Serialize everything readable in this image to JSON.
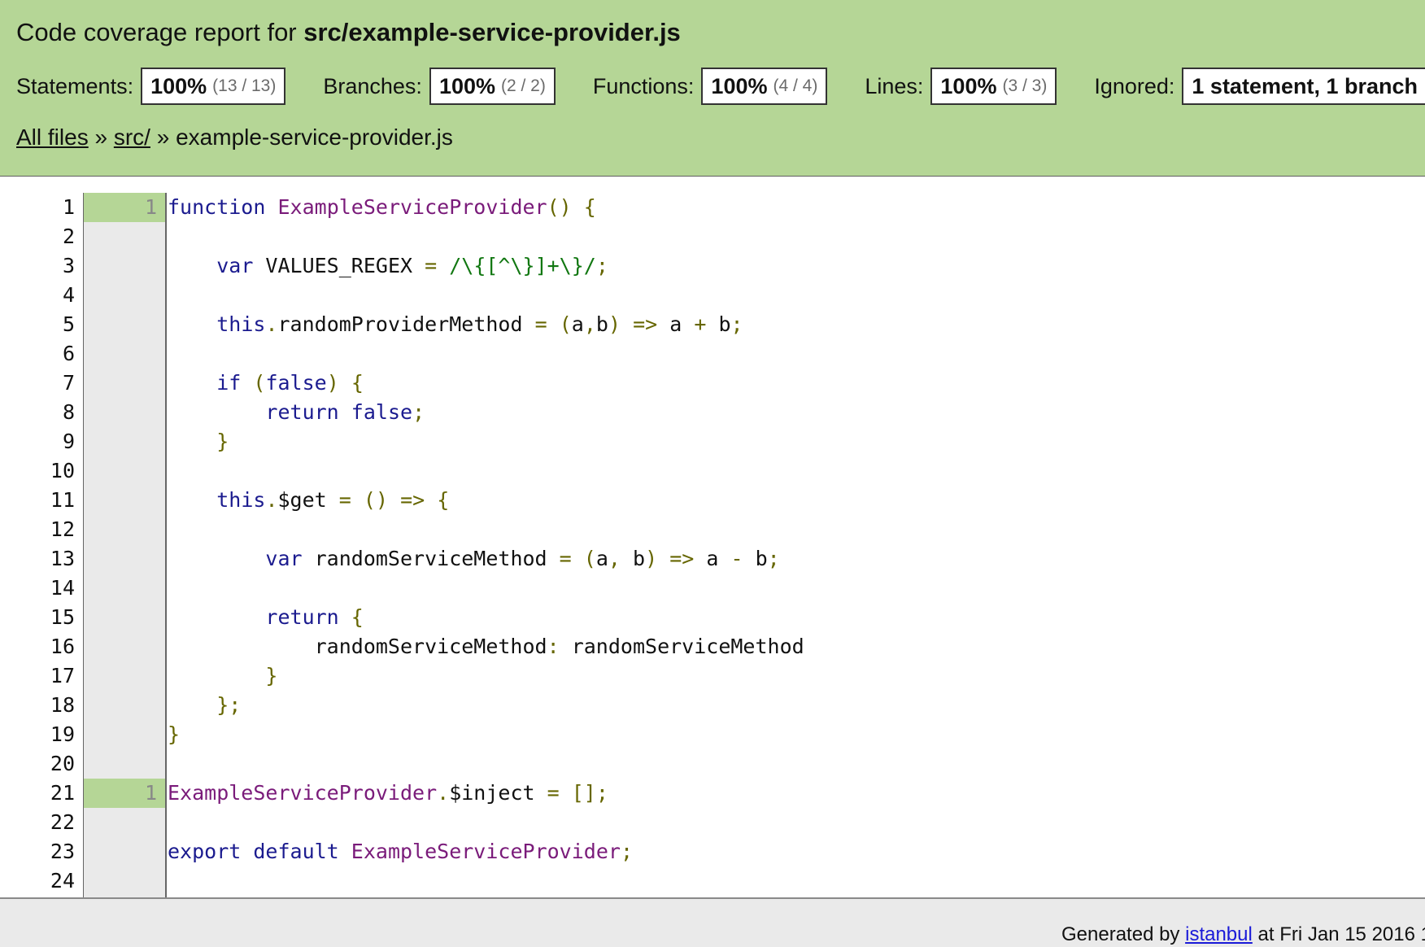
{
  "header": {
    "title_prefix": "Code coverage report for ",
    "title_file": "src/example-service-provider.js",
    "stats": [
      {
        "label": "Statements:",
        "pct": "100%",
        "frac": "(13 / 13)"
      },
      {
        "label": "Branches:",
        "pct": "100%",
        "frac": "(2 / 2)"
      },
      {
        "label": "Functions:",
        "pct": "100%",
        "frac": "(4 / 4)"
      },
      {
        "label": "Lines:",
        "pct": "100%",
        "frac": "(3 / 3)"
      }
    ],
    "ignored": {
      "label": "Ignored:",
      "value": "1 statement, 1 branch"
    },
    "colors": {
      "header_bg": "#b5d696",
      "hit": "#b5d696"
    }
  },
  "breadcrumb": {
    "all_files": "All files",
    "sep1": " » ",
    "src": "src/",
    "sep2": " » ",
    "file": "example-service-provider.js"
  },
  "code": {
    "line_numbers": [
      "1",
      "2",
      "3",
      "4",
      "5",
      "6",
      "7",
      "8",
      "9",
      "10",
      "11",
      "12",
      "13",
      "14",
      "15",
      "16",
      "17",
      "18",
      "19",
      "20",
      "21",
      "22",
      "23",
      "24"
    ],
    "counts": [
      "1",
      "",
      "",
      "",
      "",
      "",
      "",
      "",
      "",
      "",
      "",
      "",
      "",
      "",
      "",
      "",
      "",
      "",
      "",
      "",
      "1",
      "",
      "",
      ""
    ],
    "lines": [
      [
        [
          "kw",
          "function"
        ],
        [
          "pl",
          " "
        ],
        [
          "fn",
          "ExampleServiceProvider"
        ],
        [
          "pu",
          "() {"
        ]
      ],
      [],
      [
        [
          "pl",
          "    "
        ],
        [
          "kw",
          "var"
        ],
        [
          "pl",
          " VALUES_REGEX "
        ],
        [
          "pu",
          "="
        ],
        [
          "pl",
          " "
        ],
        [
          "rx",
          "/\\{[^\\}]+\\}/"
        ],
        [
          "pu",
          ";"
        ]
      ],
      [],
      [
        [
          "pl",
          "    "
        ],
        [
          "kw",
          "this"
        ],
        [
          "pu",
          "."
        ],
        [
          "pl",
          "randomProviderMethod "
        ],
        [
          "pu",
          "="
        ],
        [
          "pl",
          " "
        ],
        [
          "pu",
          "("
        ],
        [
          "pl",
          "a"
        ],
        [
          "pu",
          ","
        ],
        [
          "pl",
          "b"
        ],
        [
          "pu",
          ")"
        ],
        [
          "pl",
          " "
        ],
        [
          "pu",
          "=>"
        ],
        [
          "pl",
          " a "
        ],
        [
          "pu",
          "+"
        ],
        [
          "pl",
          " b"
        ],
        [
          "pu",
          ";"
        ]
      ],
      [],
      [
        [
          "pl",
          "    "
        ],
        [
          "kw",
          "if"
        ],
        [
          "pl",
          " "
        ],
        [
          "pu",
          "("
        ],
        [
          "kw",
          "false"
        ],
        [
          "pu",
          ")"
        ],
        [
          "pl",
          " "
        ],
        [
          "pu",
          "{"
        ]
      ],
      [
        [
          "pl",
          "        "
        ],
        [
          "kw",
          "return"
        ],
        [
          "pl",
          " "
        ],
        [
          "kw",
          "false"
        ],
        [
          "pu",
          ";"
        ]
      ],
      [
        [
          "pl",
          "    "
        ],
        [
          "pu",
          "}"
        ]
      ],
      [],
      [
        [
          "pl",
          "    "
        ],
        [
          "kw",
          "this"
        ],
        [
          "pu",
          "."
        ],
        [
          "pl",
          "$get "
        ],
        [
          "pu",
          "="
        ],
        [
          "pl",
          " "
        ],
        [
          "pu",
          "()"
        ],
        [
          "pl",
          " "
        ],
        [
          "pu",
          "=>"
        ],
        [
          "pl",
          " "
        ],
        [
          "pu",
          "{"
        ]
      ],
      [],
      [
        [
          "pl",
          "        "
        ],
        [
          "kw",
          "var"
        ],
        [
          "pl",
          " randomServiceMethod "
        ],
        [
          "pu",
          "="
        ],
        [
          "pl",
          " "
        ],
        [
          "pu",
          "("
        ],
        [
          "pl",
          "a"
        ],
        [
          "pu",
          ","
        ],
        [
          "pl",
          " b"
        ],
        [
          "pu",
          ")"
        ],
        [
          "pl",
          " "
        ],
        [
          "pu",
          "=>"
        ],
        [
          "pl",
          " a "
        ],
        [
          "pu",
          "-"
        ],
        [
          "pl",
          " b"
        ],
        [
          "pu",
          ";"
        ]
      ],
      [],
      [
        [
          "pl",
          "        "
        ],
        [
          "kw",
          "return"
        ],
        [
          "pl",
          " "
        ],
        [
          "pu",
          "{"
        ]
      ],
      [
        [
          "pl",
          "            randomServiceMethod"
        ],
        [
          "pu",
          ":"
        ],
        [
          "pl",
          " randomServiceMethod"
        ]
      ],
      [
        [
          "pl",
          "        "
        ],
        [
          "pu",
          "}"
        ]
      ],
      [
        [
          "pl",
          "    "
        ],
        [
          "pu",
          "};"
        ]
      ],
      [
        [
          "pu",
          "}"
        ]
      ],
      [],
      [
        [
          "fn",
          "ExampleServiceProvider"
        ],
        [
          "pu",
          "."
        ],
        [
          "pl",
          "$inject "
        ],
        [
          "pu",
          "="
        ],
        [
          "pl",
          " "
        ],
        [
          "pu",
          "[];"
        ]
      ],
      [],
      [
        [
          "kw",
          "export"
        ],
        [
          "pl",
          " "
        ],
        [
          "kw",
          "default"
        ],
        [
          "pl",
          " "
        ],
        [
          "fn",
          "ExampleServiceProvider"
        ],
        [
          "pu",
          ";"
        ]
      ],
      []
    ]
  },
  "footer": {
    "prefix": "Generated by ",
    "link": "istanbul",
    "suffix": " at Fri Jan 15 2016 1"
  }
}
